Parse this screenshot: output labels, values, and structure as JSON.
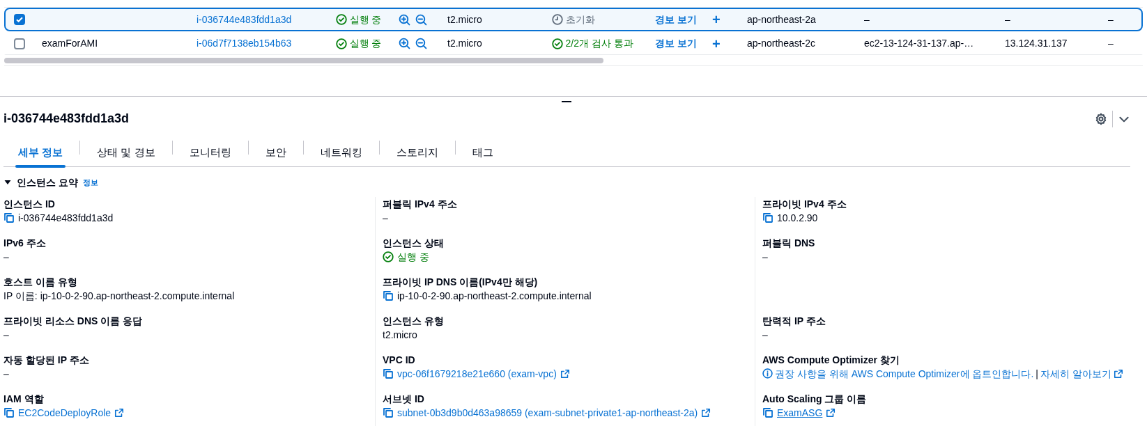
{
  "instances": {
    "rows": [
      {
        "selected": true,
        "instance_id": "i-036744e483fdd1a3d",
        "state": "실행 중",
        "type": "t2.micro",
        "status_check": {
          "kind": "initializing",
          "text": "초기화"
        },
        "alarm": "경보 보기",
        "add": "+",
        "az": "ap-northeast-2a",
        "dns": "–",
        "ip": "–",
        "column_13": "–"
      },
      {
        "selected": false,
        "name": "examForAMI",
        "instance_id": "i-06d7f7138eb154b63",
        "state": "실행 중",
        "type": "t2.micro",
        "status_check": {
          "kind": "passed",
          "text": "2/2개 검사 통과"
        },
        "alarm": "경보 보기",
        "add": "+",
        "az": "ap-northeast-2c",
        "dns": "ec2-13-124-31-137.ap-…",
        "ip": "13.124.31.137",
        "column_13": "–"
      }
    ]
  },
  "details": {
    "title": "i-036744e483fdd1a3d",
    "tabs": [
      {
        "label": "세부 정보",
        "selected": true
      },
      {
        "label": "상태 및 경보",
        "selected": false
      },
      {
        "label": "모니터링",
        "selected": false
      },
      {
        "label": "보안",
        "selected": false
      },
      {
        "label": "네트워킹",
        "selected": false
      },
      {
        "label": "스토리지",
        "selected": false
      },
      {
        "label": "태그",
        "selected": false
      }
    ],
    "section": {
      "title": "인스턴스 요약",
      "info": "정보",
      "expanded": true
    },
    "fields": [
      [
        {
          "label": "인스턴스 ID",
          "kind": "copy",
          "value": "i-036744e483fdd1a3d"
        },
        {
          "label": "퍼블릭 IPv4 주소",
          "kind": "text",
          "value": "–"
        },
        {
          "label": "프라이빗 IPv4 주소",
          "kind": "copy",
          "value": "10.0.2.90"
        }
      ],
      [
        {
          "label": "IPv6 주소",
          "kind": "text",
          "value": "–"
        },
        {
          "label": "인스턴스 상태",
          "kind": "status",
          "value": "실행 중"
        },
        {
          "label": "퍼블릭 DNS",
          "kind": "text",
          "value": "–"
        }
      ],
      [
        {
          "label": "호스트 이름 유형",
          "kind": "text",
          "value": "IP 이름: ip-10-0-2-90.ap-northeast-2.compute.internal"
        },
        {
          "label": "프라이빗 IP DNS 이름(IPv4만 해당)",
          "kind": "copy",
          "value": "ip-10-0-2-90.ap-northeast-2.compute.internal"
        },
        {
          "kind": "blank"
        }
      ],
      [
        {
          "label": "프라이빗 리소스 DNS 이름 응답",
          "kind": "text",
          "value": "–"
        },
        {
          "label": "인스턴스 유형",
          "kind": "text",
          "value": "t2.micro"
        },
        {
          "label": "탄력적 IP 주소",
          "kind": "text",
          "value": "–"
        }
      ],
      [
        {
          "label": "자동 할당된 IP 주소",
          "kind": "text",
          "value": "–"
        },
        {
          "label": "VPC ID",
          "kind": "copy-link",
          "value": "vpc-06f1679218e21e660 (exam-vpc)"
        },
        {
          "label": "AWS Compute Optimizer 찾기",
          "kind": "optimizer",
          "value": "권장 사항을 위해 AWS Compute Optimizer에 옵트인합니다.",
          "separator": "|",
          "link": "자세히 알아보기"
        }
      ],
      [
        {
          "label": "IAM 역할",
          "kind": "copy-link",
          "value": "EC2CodeDeployRole"
        },
        {
          "label": "서브넷 ID",
          "kind": "copy-link",
          "value": "subnet-0b3d9b0d463a98659 (exam-subnet-private1-ap-northeast-2a)"
        },
        {
          "label": "Auto Scaling 그룹 이름",
          "kind": "copy-link",
          "value": "ExamASG",
          "underline": true
        }
      ]
    ]
  }
}
